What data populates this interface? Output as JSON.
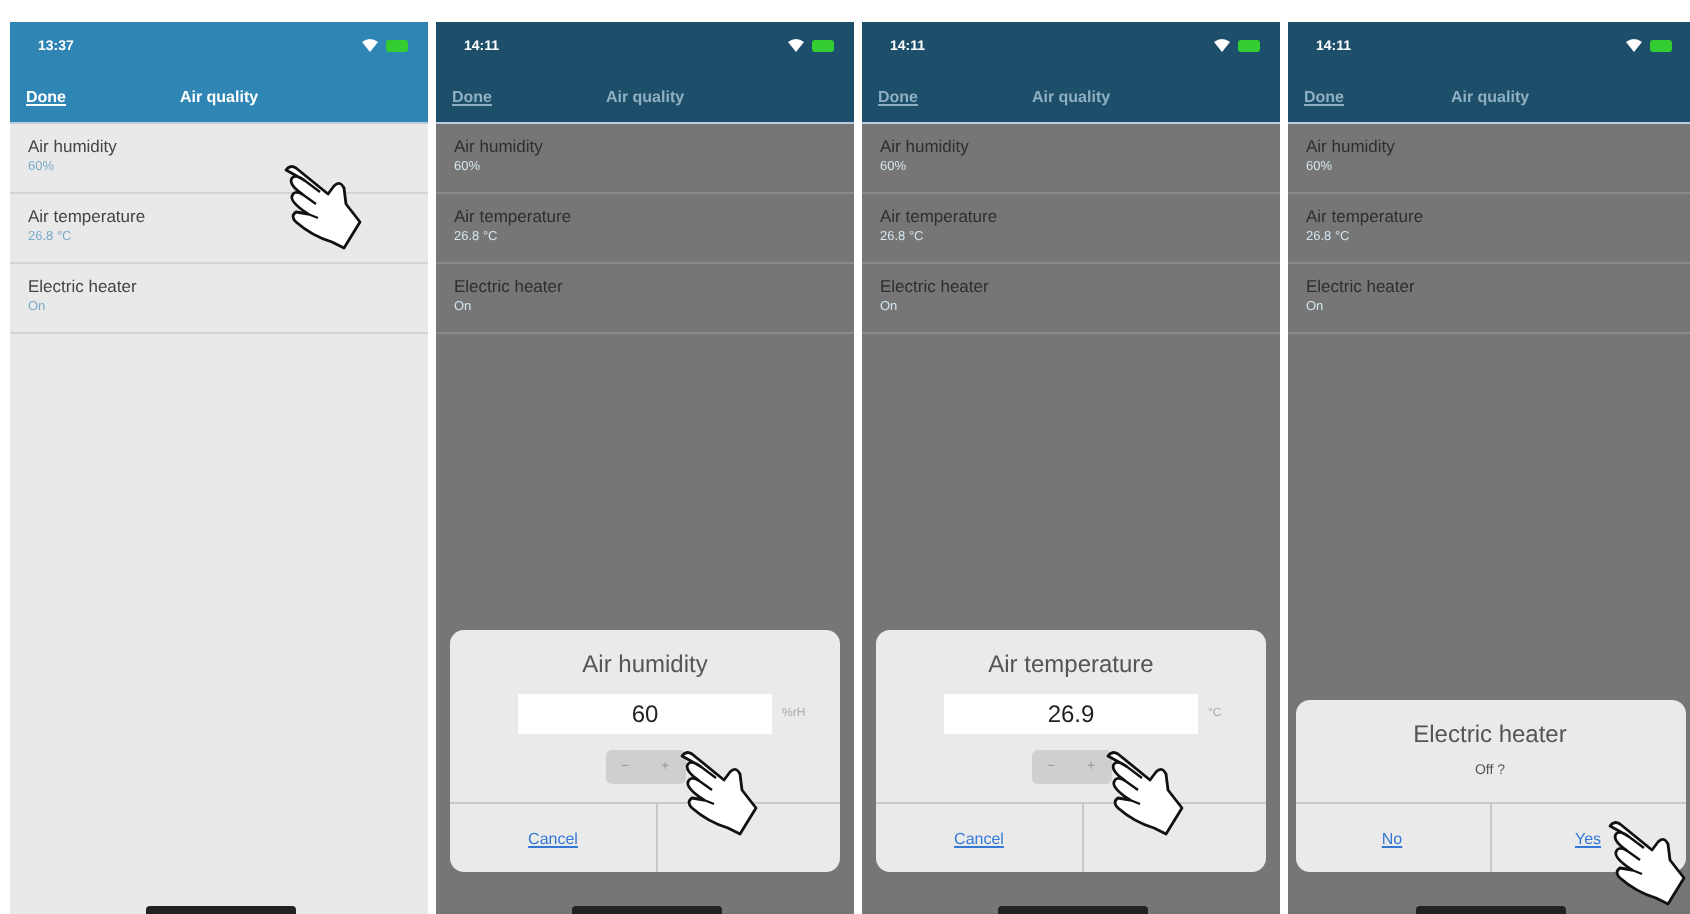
{
  "screens": [
    {
      "status_time": "13:37",
      "nav": {
        "done": "Done",
        "title": "Air quality"
      },
      "items": [
        {
          "label": "Air humidity",
          "value": "60%"
        },
        {
          "label": "Air temperature",
          "value": "26.8 °C"
        },
        {
          "label": "Electric heater",
          "value": "On"
        }
      ],
      "touch": {
        "kind": "row"
      }
    },
    {
      "status_time": "14:11",
      "nav": {
        "done": "Done",
        "title": "Air quality"
      },
      "items": [
        {
          "label": "Air humidity",
          "value": "60%"
        },
        {
          "label": "Air temperature",
          "value": "26.8 °C"
        },
        {
          "label": "Electric heater",
          "value": "On"
        }
      ],
      "touch": {
        "kind": "stepper"
      },
      "dialog": {
        "kind": "input",
        "title": "Air humidity",
        "value": "60",
        "unit": "%rH",
        "minus": "−",
        "plus": "+",
        "buttons": [
          "Cancel"
        ]
      }
    },
    {
      "status_time": "14:11",
      "nav": {
        "done": "Done",
        "title": "Air quality"
      },
      "items": [
        {
          "label": "Air humidity",
          "value": "60%"
        },
        {
          "label": "Air temperature",
          "value": "26.8 °C"
        },
        {
          "label": "Electric heater",
          "value": "On"
        }
      ],
      "touch": {
        "kind": "stepper"
      },
      "dialog": {
        "kind": "input",
        "title": "Air temperature",
        "value": "26.9",
        "unit": "°C",
        "minus": "−",
        "plus": "+",
        "buttons": [
          "Cancel"
        ]
      }
    },
    {
      "status_time": "14:11",
      "nav": {
        "done": "Done",
        "title": "Air quality"
      },
      "items": [
        {
          "label": "Air humidity",
          "value": "60%"
        },
        {
          "label": "Air temperature",
          "value": "26.8 °C"
        },
        {
          "label": "Electric heater",
          "value": "On"
        }
      ],
      "touch": {
        "kind": "button"
      },
      "dialog": {
        "kind": "confirm",
        "title": "Electric heater",
        "message": "Off ?",
        "buttons": [
          "No",
          "Yes"
        ]
      }
    }
  ]
}
